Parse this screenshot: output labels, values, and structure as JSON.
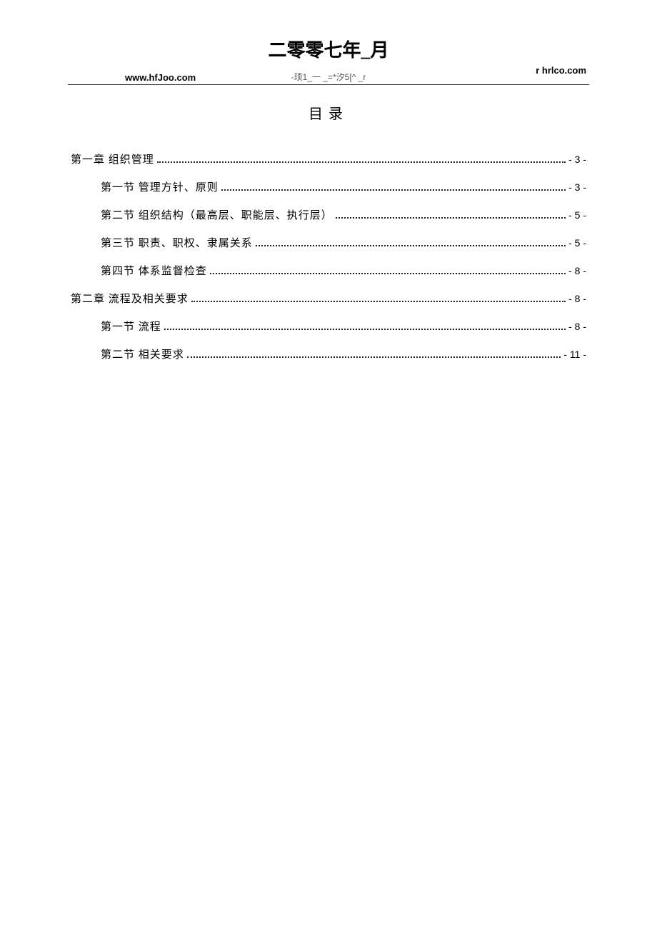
{
  "header": {
    "title": "二零零七年_月",
    "left": "www.hfJoo.com",
    "center": "-顼1_一 _=*汐5[^ _r",
    "right": "r hrlco.com"
  },
  "toc_title": "目录",
  "toc": [
    {
      "level": 1,
      "label": "第一章  组织管理",
      "page": "- 3 -"
    },
    {
      "level": 2,
      "label": "第一节  管理方针、原则",
      "page": "- 3 -"
    },
    {
      "level": 2,
      "label": "第二节  组织结构（最高层、职能层、执行层）",
      "page": "- 5 -"
    },
    {
      "level": 2,
      "label": "第三节  职责、职权、隶属关系",
      "page": "- 5 -"
    },
    {
      "level": 2,
      "label": "第四节  体系监督检查",
      "page": "- 8 -"
    },
    {
      "level": 1,
      "label": "第二章  流程及相关要求",
      "page": "- 8 -"
    },
    {
      "level": 2,
      "label": "第一节  流程",
      "page": "- 8 -"
    },
    {
      "level": 2,
      "label": "第二节  相关要求",
      "page": "- 11 -"
    }
  ]
}
